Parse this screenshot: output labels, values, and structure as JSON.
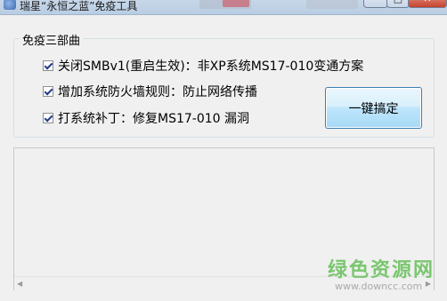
{
  "window": {
    "title": "瑞星“永恒之蓝”免疫工具",
    "min_label": "—",
    "max_label": "□",
    "close_label": "✕"
  },
  "group": {
    "title": "免疫三部曲",
    "items": [
      {
        "label": "关闭SMBv1(重启生效)：非XP系统MS17-010变通方案",
        "checked": true
      },
      {
        "label": "增加系统防火墙规则：防止网络传播",
        "checked": true
      },
      {
        "label": "打系统补丁：修复MS17-010 漏洞",
        "checked": true
      }
    ]
  },
  "action_button": {
    "label": "一键搞定"
  },
  "log": {
    "content": ""
  },
  "scrollbar": {
    "left_arrow": "◀",
    "right_arrow": "▶"
  },
  "watermark": {
    "main": "绿色资源网",
    "url": "www.downcc.com"
  },
  "colors": {
    "window_bg": "#f0f0f0",
    "button_border": "#3c7fb1",
    "watermark_green": "#7ac66f"
  }
}
